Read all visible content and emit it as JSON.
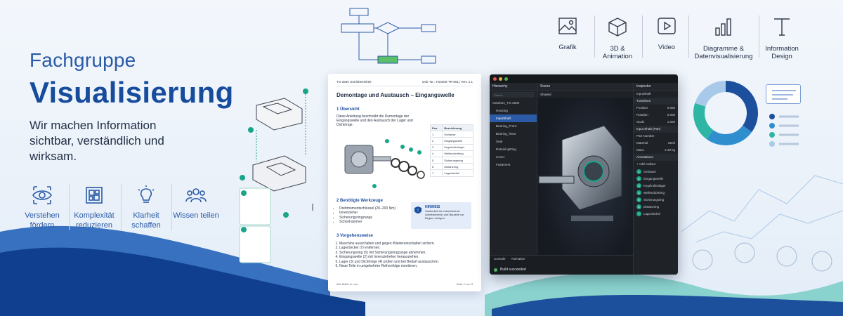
{
  "hero": {
    "kicker": "Fachgruppe",
    "title": "Visualisierung",
    "subtitle": "Wir machen Information sichtbar, verständlich und wirksam."
  },
  "features": [
    {
      "label": "Verstehen fördern",
      "icon": "eye-icon"
    },
    {
      "label": "Komplexität reduzieren",
      "icon": "layout-grid-icon"
    },
    {
      "label": "Klarheit schaffen",
      "icon": "lightbulb-icon"
    },
    {
      "label": "Wissen teilen",
      "icon": "people-icon"
    }
  ],
  "categories": [
    {
      "label": "Grafik",
      "icon": "image-icon"
    },
    {
      "label": "3D & Animation",
      "icon": "cube-icon"
    },
    {
      "label": "Video",
      "icon": "play-icon"
    },
    {
      "label": "Diagramme & Datenvisualisierung",
      "icon": "bar-chart-icon"
    },
    {
      "label": "Information Design",
      "icon": "typography-icon"
    }
  ],
  "doc": {
    "header_left": "TG-2500 Getriebeeinheit",
    "header_right": "Dok.-Nr.: TG2500-TR-001  |  Rev. 2.1",
    "title": "Demontage und Austausch – Eingangswelle",
    "s1": "1   Übersicht",
    "s1_text": "Diese Anleitung beschreibt die Demontage der Eingangswelle und den Austausch der Lager und Dichtringe.",
    "table_headers": [
      "Pos.",
      "Bezeichnung"
    ],
    "table_rows": [
      [
        "1",
        "Gehäuse"
      ],
      [
        "2",
        "Eingangswelle"
      ],
      [
        "3",
        "Kegelrollenlager"
      ],
      [
        "4",
        "Wellendichtring"
      ],
      [
        "5",
        "Sicherungsring"
      ],
      [
        "6",
        "Distanzring"
      ],
      [
        "7",
        "Lagerdeckel"
      ]
    ],
    "s2": "2   Benötigte Werkzeuge",
    "tools": [
      "Drehmomentschlüssel (20–200 Nm)",
      "Innenzieher",
      "Sicherungsringzange",
      "Schonhammer"
    ],
    "hint_title": "HINWEIS",
    "hint_text": "Sauberkeit ist entscheidend. Arbeitsbereich und Bauteile vor Beginn reinigen.",
    "s3": "3   Vorgehensweise",
    "steps": [
      "Maschine ausschalten und gegen Wiedereinschalten sichern.",
      "Lagerdeckel (7) entfernen.",
      "Sicherungsring (5) mit Sicherungsringzange abnehmen.",
      "Eingangswelle (2) mit Innenzieheher herausziehen.",
      "Lager (3) und Dichtringe (4) prüfen und bei Bedarf austauschen.",
      "Neue Teile in umgekehrter Reihenfolge montieren."
    ],
    "footer_left": "Alle Maße in mm.",
    "footer_right": "Seite 1 von 3"
  },
  "app": {
    "hierarchy_title": "Hierarchy",
    "search_placeholder": "Search",
    "nodes": [
      "Gearbox_TG-2500",
      "Housing",
      "InputShaft",
      "Bearing_Front",
      "Bearing_Rear",
      "Seal",
      "RetainingRing",
      "Cover",
      "Fasteners"
    ],
    "selected_node": "InputShaft",
    "scene_title": "Scene",
    "shading": "Shaded",
    "inspector_title": "Inspector",
    "inspector_name": "InputShaft",
    "transform": "Transform",
    "props": [
      [
        "Position",
        "0.000"
      ],
      [
        "Rotation",
        "0.000"
      ],
      [
        "Scale",
        "1.000"
      ]
    ],
    "input_shaft_section": "Input Shaft (Part)",
    "part_number": "Part Number",
    "material_label": "Material",
    "material_value": "Steel",
    "mass_label": "Mass",
    "mass_value": "2.48 kg",
    "annotations_title": "Annotations",
    "add_callout": "+ Add Callout",
    "annotations": [
      "Gehäuse",
      "Eingangswelle",
      "Kegelrollenlager",
      "Wellendichtring",
      "Sicherungsring",
      "Distanzring",
      "Lagerdeckel"
    ],
    "console_tab": "Console",
    "animation_tab": "Animation",
    "status": "Build succeeded"
  },
  "donut": {
    "segments": [
      {
        "value": 35,
        "color": "#1c4f9c"
      },
      {
        "value": 25,
        "color": "#2f8fce"
      },
      {
        "value": 20,
        "color": "#2fb5a4"
      },
      {
        "value": 20,
        "color": "#a9c9ea"
      }
    ]
  },
  "colors": {
    "accent": "#174b9c",
    "teal": "#19a58a"
  }
}
